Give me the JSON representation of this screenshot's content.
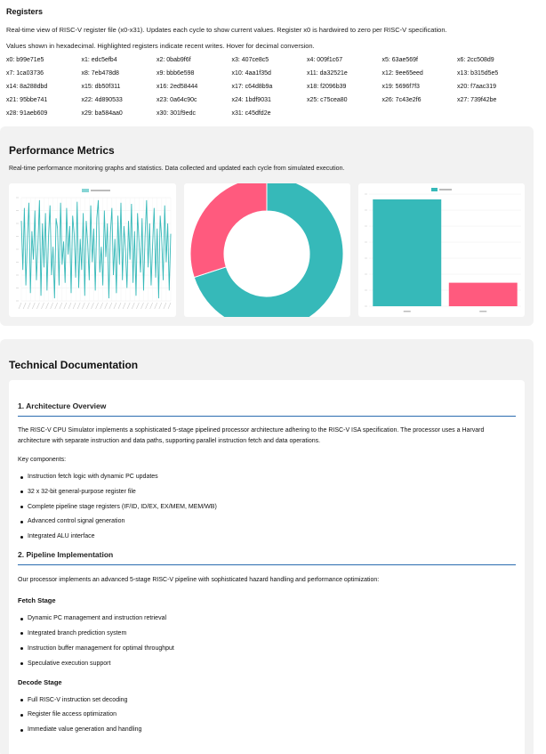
{
  "registers": {
    "title": "Registers",
    "description": "Real-time view of RISC-V register file (x0-x31). Updates each cycle to show current values. Register x0 is hardwired to zero per RISC-V specification.",
    "note": "Values shown in hexadecimal. Highlighted registers indicate recent writes. Hover for decimal conversion.",
    "items": [
      "x0: b99e71e5",
      "x1: edc5efb4",
      "x2: 0bab9f6f",
      "x3: 407ce8c5",
      "x4: 009f1c67",
      "x5: 63ae569f",
      "x6: 2cc508d9",
      "x7: 1ca03736",
      "x8: 7eb478d8",
      "x9: bbb6e598",
      "x10: 4aa1f35d",
      "x11: da32521e",
      "x12: 9ee65eed",
      "x13: b315d5e5",
      "x14: 8a288dbd",
      "x15: db50f311",
      "x16: 2ed58444",
      "x17: c64d8b9a",
      "x18: f2096b39",
      "x19: 5696f7f3",
      "x20: f7aac319",
      "x21: 95bbe741",
      "x22: 4d890533",
      "x23: 0a64c90c",
      "x24: 1bdf9031",
      "x25: c75cea80",
      "x26: 7c43e2f6",
      "x27: 739f42be",
      "x28: 91aeb609",
      "x29: ba584aa0",
      "x30: 301f9edc",
      "x31: c45dfd2e"
    ]
  },
  "performance": {
    "title": "Performance Metrics",
    "description": "Real-time performance monitoring graphs and statistics. Data collected and updated each cycle from simulated execution."
  },
  "chart_data": [
    {
      "type": "line",
      "series": [
        {
          "name": "",
          "color": "#36b9b9"
        }
      ],
      "values": [
        0.55,
        -0.4,
        0.8,
        -0.7,
        0.2,
        0.9,
        -0.85,
        0.35,
        -0.2,
        0.75,
        -0.6,
        0.1,
        0.95,
        -0.9,
        0.5,
        -0.35,
        0.7,
        -0.8,
        0.25,
        0.85,
        -0.5,
        0.05,
        -0.95,
        0.6,
        0.4,
        -0.7,
        0.9,
        -0.3,
        0.15,
        -0.65,
        0.8,
        -0.1,
        0.45,
        -0.85,
        0.65,
        0.3,
        -0.55,
        0.92,
        -0.75,
        0.2,
        -0.4,
        0.7,
        -0.9,
        0.55,
        0.1,
        -0.6,
        0.85,
        -0.25,
        0.4,
        -0.8,
        0.6,
        0.95,
        -0.45,
        0.05,
        -0.7,
        0.75,
        -0.15,
        0.5,
        -0.95,
        0.3,
        0.8,
        -0.5,
        0.2,
        -0.85,
        0.65,
        -0.3,
        0.9,
        -0.6,
        0.45,
        0.0,
        -0.75,
        0.55,
        -0.2,
        0.88,
        -0.65,
        0.35,
        -0.9,
        0.7,
        0.15,
        -0.45,
        0.6,
        -0.8,
        0.25,
        0.95,
        -0.35,
        0.5,
        -0.7,
        0.1,
        0.8,
        -0.55,
        0.4,
        -0.95,
        0.65,
        0.2,
        -0.6,
        0.85,
        -0.25,
        0.5,
        -0.8,
        0.3
      ],
      "ylim": [
        -1,
        1
      ],
      "grid": true,
      "legend_position": "top"
    },
    {
      "type": "pie",
      "slices": [
        {
          "label": "",
          "value": 70,
          "color": "#36b9b9"
        },
        {
          "label": "",
          "value": 30,
          "color": "#ff5a7e"
        }
      ],
      "legend_position": "top"
    },
    {
      "type": "bar",
      "categories": [
        "",
        ""
      ],
      "series": [
        {
          "name": "",
          "values": [
            100,
            22
          ],
          "colors": [
            "#36b9b9",
            "#ff5a7e"
          ]
        }
      ],
      "ylim": [
        0,
        105
      ],
      "grid": true,
      "legend_position": "top"
    }
  ],
  "docs": {
    "title": "Technical Documentation",
    "section1": {
      "heading": "1. Architecture Overview",
      "paragraph": "The RISC-V CPU Simulator implements a sophisticated 5-stage pipelined processor architecture adhering to the RISC-V ISA specification. The processor uses a Harvard architecture with separate instruction and data paths, supporting parallel instruction fetch and data operations.",
      "components_label": "Key components:",
      "items": [
        "Instruction fetch logic with dynamic PC updates",
        "32 x 32-bit general-purpose register file",
        "Complete pipeline stage registers (IF/ID, ID/EX, EX/MEM, MEM/WB)",
        "Advanced control signal generation",
        "Integrated ALU interface"
      ]
    },
    "section2": {
      "heading": "2. Pipeline Implementation",
      "paragraph": "Our processor implements an advanced 5-stage RISC-V pipeline with sophisticated hazard handling and performance optimization:",
      "fetch": {
        "heading": "Fetch Stage",
        "items": [
          "Dynamic PC management and instruction retrieval",
          "Integrated branch prediction system",
          "Instruction buffer management for optimal throughput",
          "Speculative execution support"
        ]
      },
      "decode": {
        "heading": "Decode Stage",
        "items": [
          "Full RISC-V instruction set decoding",
          "Register file access optimization",
          "Immediate value generation and handling"
        ]
      }
    }
  }
}
